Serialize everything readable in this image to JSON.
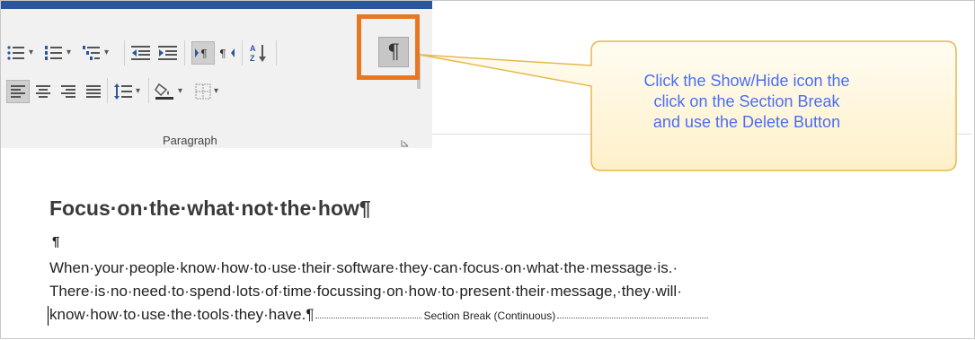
{
  "ribbon": {
    "group_label": "Paragraph",
    "buttons": [
      {
        "name": "bullets",
        "icon": "bullets-icon"
      },
      {
        "name": "numbering",
        "icon": "numbering-icon"
      },
      {
        "name": "multilevel-list",
        "icon": "multilevel-list-icon"
      },
      {
        "name": "decrease-indent",
        "icon": "decrease-indent-icon"
      },
      {
        "name": "increase-indent",
        "icon": "increase-indent-icon"
      },
      {
        "name": "ltr-text-direction",
        "icon": "ltr-paragraph-icon"
      },
      {
        "name": "rtl-text-direction",
        "icon": "rtl-paragraph-icon"
      },
      {
        "name": "sort",
        "icon": "sort-az-icon"
      },
      {
        "name": "show-hide",
        "icon": "pilcrow-icon",
        "symbol": "¶",
        "state": "active"
      },
      {
        "name": "align-left",
        "icon": "align-left-icon",
        "state": "active"
      },
      {
        "name": "center",
        "icon": "align-center-icon"
      },
      {
        "name": "align-right",
        "icon": "align-right-icon"
      },
      {
        "name": "justify",
        "icon": "justify-icon"
      },
      {
        "name": "line-spacing",
        "icon": "line-spacing-icon"
      },
      {
        "name": "shading",
        "icon": "paint-bucket-icon"
      },
      {
        "name": "borders",
        "icon": "borders-icon"
      }
    ]
  },
  "callout": {
    "text_lines": [
      "Click the Show/Hide icon the",
      "click on the Section Break",
      "and use the Delete Button"
    ]
  },
  "document": {
    "heading": "Focus·on·the·what·not·the·how¶",
    "empty_paragraph": "¶",
    "lines": [
      "When·your·people·know·how·to·use·their·software·they·can·focus·on·what·the·message·is.·",
      "There·is·no·need·to·spend·lots·of·time·focussing·on·how·to·present·their·message,·they·will·",
      "know·how·to·use·the·tools·they·have.¶"
    ],
    "section_break": "Section Break (Continuous)"
  },
  "colors": {
    "highlight": "#e87722",
    "callout_fill": "#fff6df",
    "callout_border": "#e6b84a",
    "callout_text": "#4a6ef5",
    "ribbon_accent": "#2b579a"
  }
}
